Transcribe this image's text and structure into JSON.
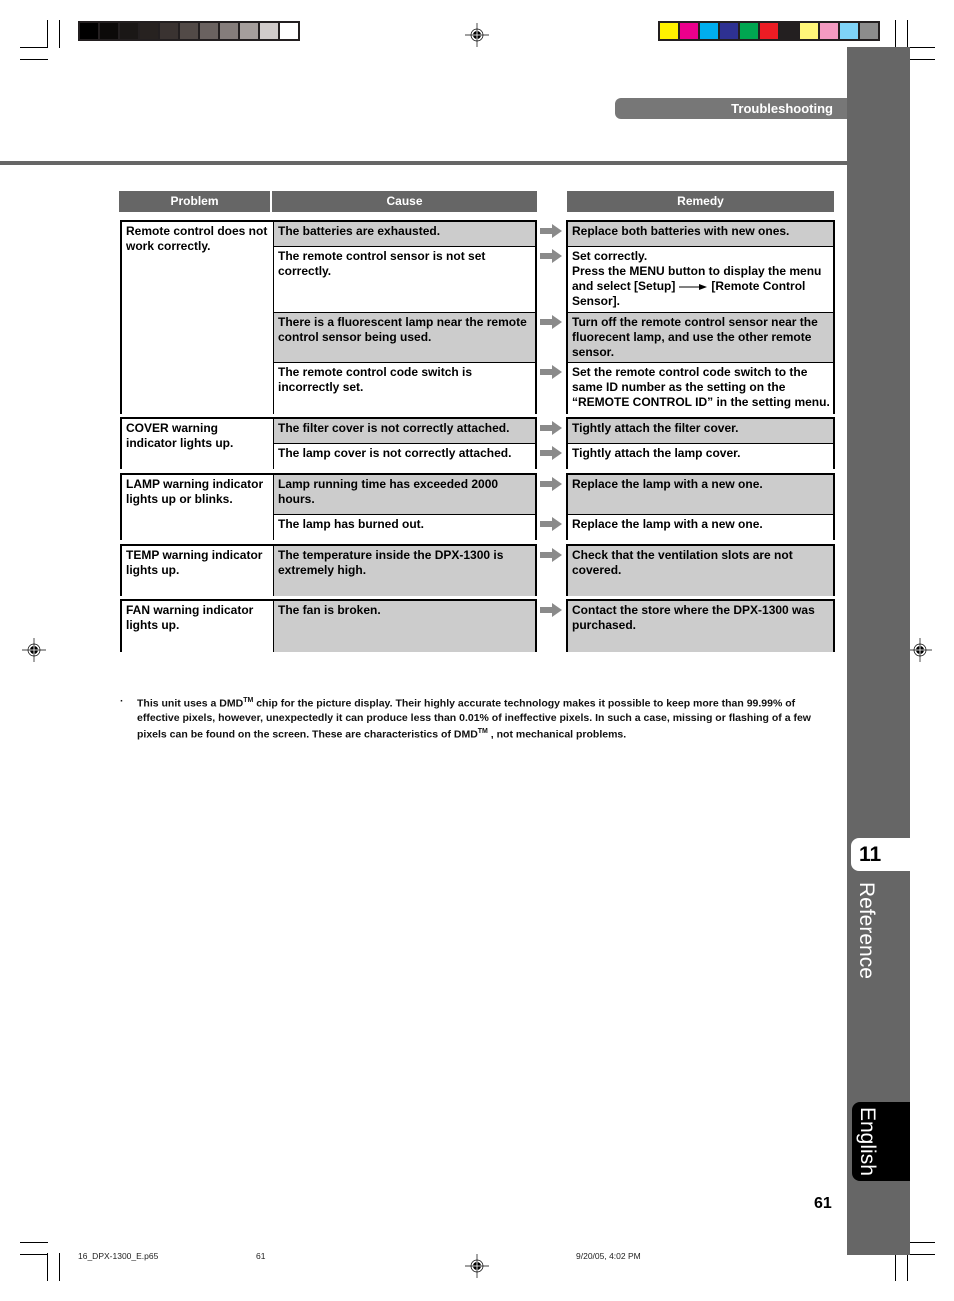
{
  "print_marks": {
    "gray_swatches": [
      "#000000",
      "#0c0a09",
      "#1a1716",
      "#272220",
      "#3a3331",
      "#524a47",
      "#6a6260",
      "#857d7b",
      "#a59e9c",
      "#d0cbca",
      "#ffffff"
    ],
    "color_swatches": [
      "#fff200",
      "#ec008c",
      "#00aeef",
      "#2e3192",
      "#00a651",
      "#ed1c24",
      "#231f20",
      "#fff679",
      "#f49ac1",
      "#7fd3f7",
      "#8c8c8c"
    ]
  },
  "header": {
    "section_title": "Troubleshooting"
  },
  "table": {
    "columns": {
      "problem": "Problem",
      "cause": "Cause",
      "remedy": "Remedy"
    },
    "groups": [
      {
        "problem": "Remote control does not work correctly.",
        "rows": [
          {
            "cause": "The batteries are exhausted.",
            "remedy": "Replace both batteries with new ones.",
            "shade": "gray"
          },
          {
            "cause": "The remote control sensor is not set correctly.",
            "remedy_lines": [
              "Set correctly.",
              "Press the MENU button to display the menu and select [Setup]",
              "[Remote Control Sensor]."
            ],
            "shade": "white"
          },
          {
            "cause": "There is a fluorescent lamp near the remote control sensor being used.",
            "remedy": "Turn off the remote control sensor near the fluorecent lamp, and use the other remote sensor.",
            "shade": "gray"
          },
          {
            "cause": "The remote control code switch is incorrectly set.",
            "remedy": "Set the remote control code switch to the same ID number as the setting on the “REMOTE CONTROL ID” in the setting menu.",
            "shade": "white"
          }
        ]
      },
      {
        "problem": "COVER warning indicator lights up.",
        "rows": [
          {
            "cause": "The filter cover is not correctly attached.",
            "remedy": "Tightly attach the filter cover.",
            "shade": "gray"
          },
          {
            "cause": "The lamp cover is not correctly attached.",
            "remedy": "Tightly attach the lamp cover.",
            "shade": "white"
          }
        ]
      },
      {
        "problem": "LAMP warning indicator lights up or blinks.",
        "rows": [
          {
            "cause": "Lamp running time has exceeded 2000 hours.",
            "remedy": "Replace the lamp with a new one.",
            "shade": "gray"
          },
          {
            "cause": "The lamp has burned out.",
            "remedy": "Replace the lamp with a new one.",
            "shade": "white"
          }
        ]
      },
      {
        "problem": "TEMP warning indicator lights up.",
        "rows": [
          {
            "cause": "The temperature inside the DPX-1300 is extremely high.",
            "remedy": "Check that the ventilation slots are not covered.",
            "shade": "gray"
          }
        ]
      },
      {
        "problem": "FAN warning indicator lights up.",
        "rows": [
          {
            "cause": "The fan is broken.",
            "remedy": "Contact the store where the DPX-1300 was purchased.",
            "shade": "gray"
          }
        ]
      }
    ]
  },
  "note": {
    "bullet": "·",
    "part1": "This unit uses a DMD",
    "tm": "TM",
    "part2": " chip for the picture display. Their highly accurate technology makes it possible to keep more than 99.99% of effective pixels, however, unexpectedly it can produce less than 0.01% of ineffective pixels. In such a case, missing or flashing of a few pixels can be found on the screen. These are characteristics of DMD",
    "part3": " , not mechanical problems."
  },
  "side_tab": {
    "chapter_number": "11",
    "chapter_title": "Reference",
    "language": "English"
  },
  "page_number": "61",
  "footer": {
    "file": "16_DPX-1300_E.p65",
    "page": "61",
    "datetime": "9/20/05, 4:02 PM"
  }
}
